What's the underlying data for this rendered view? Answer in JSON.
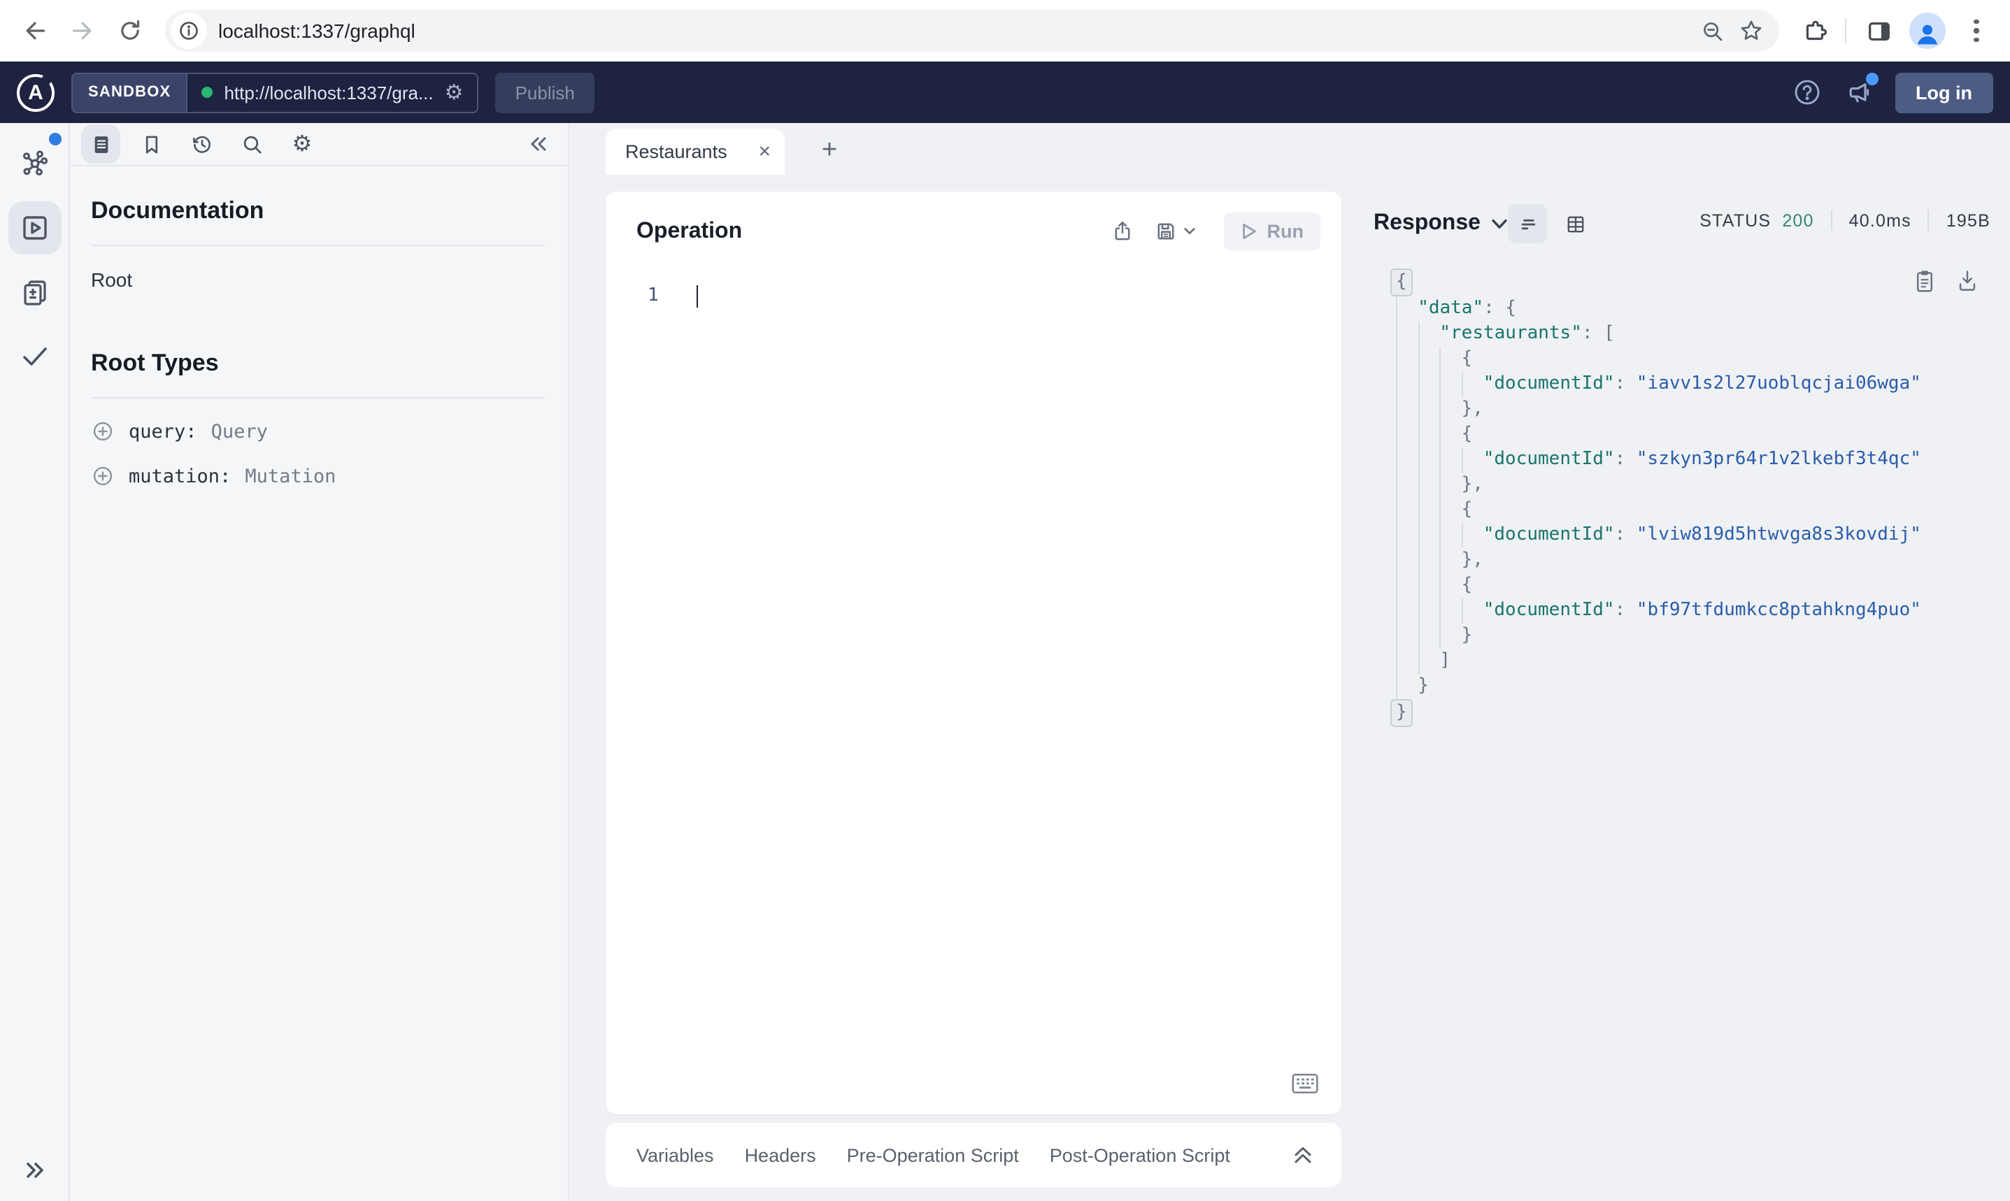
{
  "browser": {
    "url": "localhost:1337/graphql"
  },
  "apollo_header": {
    "logo_letter": "A",
    "env_label": "SANDBOX",
    "endpoint_url": "http://localhost:1337/gra...",
    "gear_glyph": "⚙",
    "publish_label": "Publish",
    "login_label": "Log in"
  },
  "docs_panel": {
    "title": "Documentation",
    "root_link": "Root",
    "root_types_title": "Root Types",
    "root_types": [
      {
        "field": "query:",
        "type": "Query"
      },
      {
        "field": "mutation:",
        "type": "Mutation"
      }
    ]
  },
  "tabs": {
    "active_tab": "Restaurants",
    "close_glyph": "×",
    "new_tab_glyph": "+"
  },
  "operation": {
    "title": "Operation",
    "run_label": "Run",
    "line_number": "1"
  },
  "footer": {
    "tabs": [
      "Variables",
      "Headers",
      "Pre-Operation Script",
      "Post-Operation Script"
    ]
  },
  "response": {
    "title": "Response",
    "status_label": "STATUS",
    "status_code": "200",
    "duration": "40.0ms",
    "size": "195B",
    "json_lines": [
      {
        "i": 0,
        "t": [
          [
            "b",
            "{"
          ]
        ]
      },
      {
        "i": 1,
        "t": [
          [
            "key",
            "\"data\""
          ],
          [
            "p",
            ": {"
          ]
        ]
      },
      {
        "i": 2,
        "t": [
          [
            "key",
            "\"restaurants\""
          ],
          [
            "p",
            ": ["
          ]
        ]
      },
      {
        "i": 3,
        "t": [
          [
            "p",
            "{"
          ]
        ]
      },
      {
        "i": 4,
        "t": [
          [
            "key",
            "\"documentId\""
          ],
          [
            "p",
            ": "
          ],
          [
            "str",
            "\"iavv1s2l27uoblqcjai06wga\""
          ]
        ]
      },
      {
        "i": 3,
        "t": [
          [
            "p",
            "},"
          ]
        ]
      },
      {
        "i": 3,
        "t": [
          [
            "p",
            "{"
          ]
        ]
      },
      {
        "i": 4,
        "t": [
          [
            "key",
            "\"documentId\""
          ],
          [
            "p",
            ": "
          ],
          [
            "str",
            "\"szkyn3pr64r1v2lkebf3t4qc\""
          ]
        ]
      },
      {
        "i": 3,
        "t": [
          [
            "p",
            "},"
          ]
        ]
      },
      {
        "i": 3,
        "t": [
          [
            "p",
            "{"
          ]
        ]
      },
      {
        "i": 4,
        "t": [
          [
            "key",
            "\"documentId\""
          ],
          [
            "p",
            ": "
          ],
          [
            "str",
            "\"lviw819d5htwvga8s3kovdij\""
          ]
        ]
      },
      {
        "i": 3,
        "t": [
          [
            "p",
            "},"
          ]
        ]
      },
      {
        "i": 3,
        "t": [
          [
            "p",
            "{"
          ]
        ]
      },
      {
        "i": 4,
        "t": [
          [
            "key",
            "\"documentId\""
          ],
          [
            "p",
            ": "
          ],
          [
            "str",
            "\"bf97tfdumkcc8ptahkng4puo\""
          ]
        ]
      },
      {
        "i": 3,
        "t": [
          [
            "p",
            "}"
          ]
        ]
      },
      {
        "i": 2,
        "t": [
          [
            "p",
            "]"
          ]
        ]
      },
      {
        "i": 1,
        "t": [
          [
            "p",
            "}"
          ]
        ]
      },
      {
        "i": 0,
        "t": [
          [
            "b",
            "}"
          ]
        ]
      }
    ]
  },
  "colors": {
    "header_navy": "#1d2340",
    "status_green": "#38866f",
    "json_key_teal": "#18756c",
    "json_string_blue": "#2a5caa",
    "endpoint_dot_green": "#2bb673"
  }
}
